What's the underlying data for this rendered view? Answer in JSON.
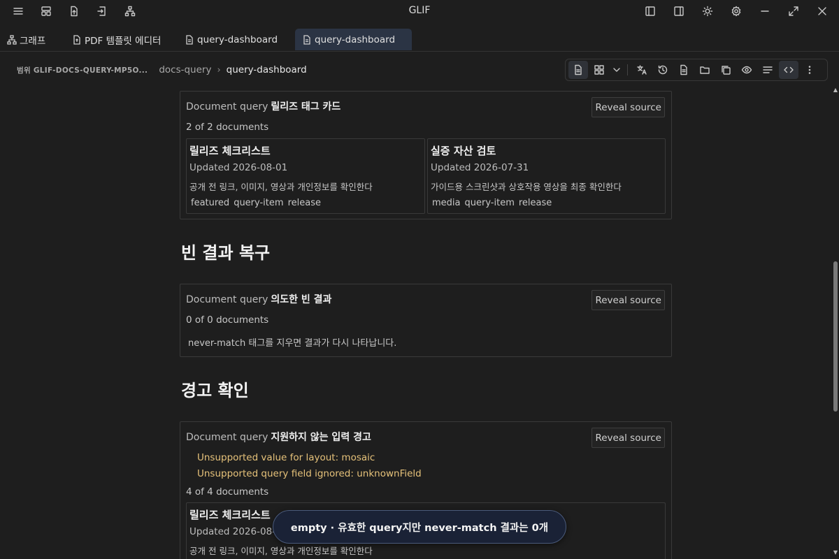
{
  "app": {
    "title": "GLIF"
  },
  "tabs": [
    {
      "label": "그래프",
      "icon": "graph-icon"
    },
    {
      "label": "PDF 템플릿 에디터",
      "icon": "pdf-file-icon"
    },
    {
      "label": "query-dashboard",
      "icon": "document-icon"
    },
    {
      "label": "query-dashboard",
      "icon": "document-icon",
      "active": true
    }
  ],
  "breadcrumb": {
    "scope": "범위 GLIF-DOCS-QUERY-MP5O...",
    "folder": "docs-query",
    "current": "query-dashboard"
  },
  "blocks": {
    "release_tags": {
      "prefix": "Document query",
      "name": "릴리즈 태그 카드",
      "reveal": "Reveal source",
      "count": "2 of 2 documents",
      "cards": [
        {
          "title": "릴리즈 체크리스트",
          "updated": "Updated 2026-08-01",
          "desc": "공개 전 링크, 이미지, 영상과 개인정보를 확인한다",
          "tags": [
            "featured",
            "query-item",
            "release"
          ]
        },
        {
          "title": "실증 자산 검토",
          "updated": "Updated 2026-07-31",
          "desc": "가이드용 스크린샷과 상호작용 영상을 최종 확인한다",
          "tags": [
            "media",
            "query-item",
            "release"
          ]
        }
      ]
    },
    "empty": {
      "heading": "빈 결과 복구",
      "prefix": "Document query",
      "name": "의도한 빈 결과",
      "reveal": "Reveal source",
      "count": "0 of 0 documents",
      "message": "never-match 태그를 지우면 결과가 다시 나타납니다."
    },
    "warnings": {
      "heading": "경고 확인",
      "prefix": "Document query",
      "name": "지원하지 않는 입력 경고",
      "reveal": "Reveal source",
      "warnings": [
        "Unsupported value for layout: mosaic",
        "Unsupported query field ignored: unknownField"
      ],
      "count": "4 of 4 documents",
      "card": {
        "title": "릴리즈 체크리스트",
        "updated": "Updated 2026-08-",
        "desc": "공개 전 링크, 이미지, 영상과 개인정보를 확인한다"
      }
    }
  },
  "toast": "empty · 유효한 query지만 never-match 결과는 0개",
  "colors": {
    "accent_tab": "#2b3444",
    "warning_text": "#e6c27a",
    "toast_bg": "#1a2236"
  }
}
